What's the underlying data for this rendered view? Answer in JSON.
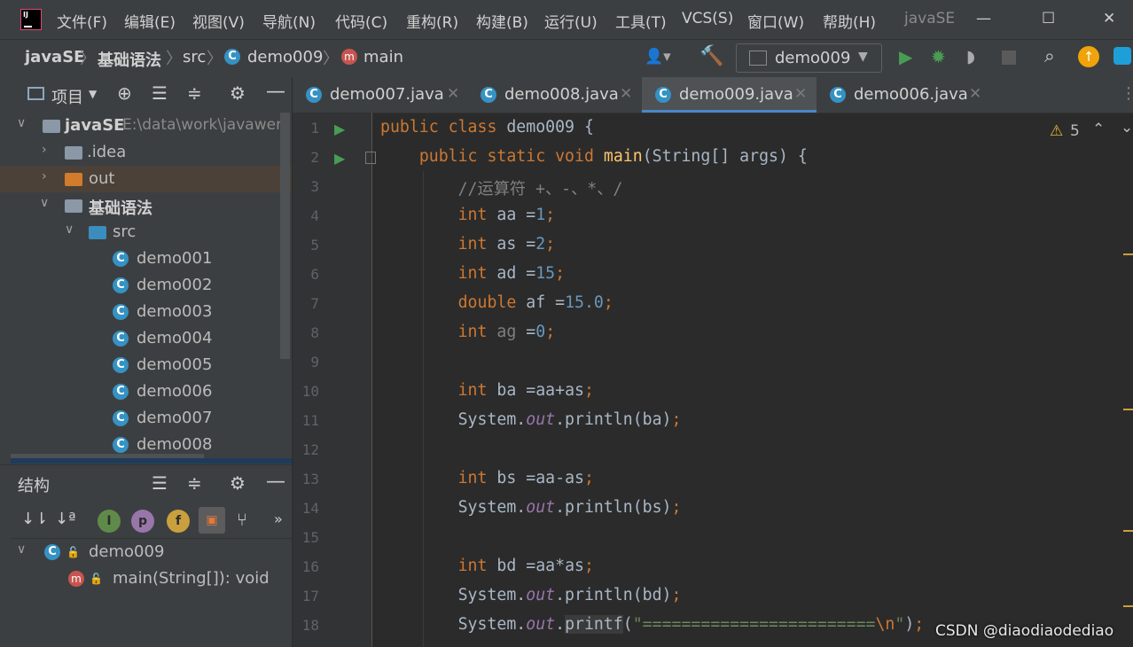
{
  "menubar": {
    "logo": "IJ",
    "items": [
      "文件(F)",
      "编辑(E)",
      "视图(V)",
      "导航(N)",
      "代码(C)",
      "重构(R)",
      "构建(B)",
      "运行(U)",
      "工具(T)",
      "VCS(S)",
      "窗口(W)",
      "帮助(H)"
    ],
    "app_name": "javaSE",
    "window_controls": {
      "minimize": "—",
      "maximize": "☐",
      "close": "✕"
    }
  },
  "navbar": {
    "crumbs": [
      "javaSE",
      "基础语法",
      "src",
      "demo009",
      "main"
    ],
    "class_badge": "C",
    "method_badge": "m",
    "run_config": "demo009"
  },
  "project_panel": {
    "title": "项目",
    "tree": [
      {
        "label": "javaSE",
        "path": "E:\\data\\work\\javawenj",
        "indent": 0,
        "open": true,
        "kind": "module"
      },
      {
        "label": ".idea",
        "indent": 1,
        "open": false,
        "kind": "folder"
      },
      {
        "label": "out",
        "indent": 1,
        "open": false,
        "kind": "folder-out"
      },
      {
        "label": "基础语法",
        "indent": 1,
        "open": true,
        "kind": "module"
      },
      {
        "label": "src",
        "indent": 2,
        "open": true,
        "kind": "src"
      },
      {
        "label": "demo001",
        "indent": 3,
        "kind": "class"
      },
      {
        "label": "demo002",
        "indent": 3,
        "kind": "class"
      },
      {
        "label": "demo003",
        "indent": 3,
        "kind": "class"
      },
      {
        "label": "demo004",
        "indent": 3,
        "kind": "class"
      },
      {
        "label": "demo005",
        "indent": 3,
        "kind": "class"
      },
      {
        "label": "demo006",
        "indent": 3,
        "kind": "class"
      },
      {
        "label": "demo007",
        "indent": 3,
        "kind": "class"
      },
      {
        "label": "demo008",
        "indent": 3,
        "kind": "class"
      }
    ]
  },
  "structure_panel": {
    "title": "结构",
    "filter_badges": [
      "I",
      "p",
      "f"
    ],
    "more": "»",
    "items": [
      {
        "label": "demo009",
        "indent": 0,
        "kind": "class"
      },
      {
        "label": "main(String[]): void",
        "indent": 1,
        "kind": "method"
      }
    ]
  },
  "editor": {
    "tabs": [
      {
        "label": "demo007.java",
        "active": false
      },
      {
        "label": "demo008.java",
        "active": false
      },
      {
        "label": "demo009.java",
        "active": true
      },
      {
        "label": "demo006.java",
        "active": false
      }
    ],
    "warnings": "5",
    "lines": [
      "<span class='kw'>public class</span> demo009 {",
      "    <span class='kw'>public static void</span> <span class='fn'>main</span>(String[] args) {",
      "        <span class='cmt'>//运算符 +、-、*、/</span>",
      "        <span class='kw'>int</span> aa =<span class='num'>1</span><span class='kw'>;</span>",
      "        <span class='kw'>int</span> as =<span class='num'>2</span><span class='kw'>;</span>",
      "        <span class='kw'>int</span> ad =<span class='num'>15</span><span class='kw'>;</span>",
      "        <span class='kw'>double</span> af =<span class='num'>15.0</span><span class='kw'>;</span>",
      "        <span class='kw'>int</span> <span class='cmt'>ag</span> =<span class='num'>0</span><span class='kw'>;</span>",
      "",
      "        <span class='kw'>int</span> ba =aa+as<span class='kw'>;</span>",
      "        System.<span class='fld'>out</span>.println(ba)<span class='kw'>;</span>",
      "",
      "        <span class='kw'>int</span> bs =aa-as<span class='kw'>;</span>",
      "        System.<span class='fld'>out</span>.println(bs)<span class='kw'>;</span>",
      "",
      "        <span class='kw'>int</span> bd =aa*as<span class='kw'>;</span>",
      "        System.<span class='fld'>out</span>.println(bd)<span class='kw'>;</span>",
      "        System.<span class='fld'>out</span>.<span class='hl'>printf</span>(<span class='str'>\"========================</span><span class='kw'>\\n</span><span class='str'>\"</span>)<span class='kw'>;</span>"
    ],
    "line_numbers": [
      "1",
      "2",
      "3",
      "4",
      "5",
      "6",
      "7",
      "8",
      "9",
      "10",
      "11",
      "12",
      "13",
      "14",
      "15",
      "16",
      "17",
      "18"
    ]
  },
  "watermark": "CSDN @diaodiaodediao",
  "colors": {
    "accent": "#3592c4",
    "run": "#499c54",
    "bg": "#2b2b2b",
    "panel": "#3c3f41"
  }
}
